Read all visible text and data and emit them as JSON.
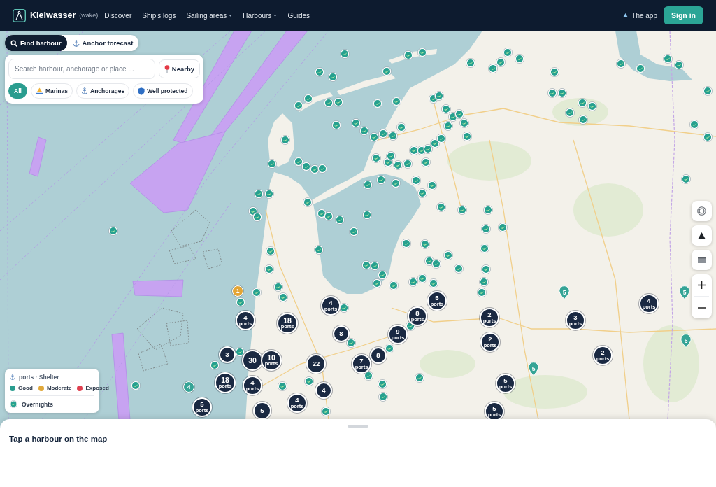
{
  "navbar": {
    "brand": {
      "name": "Kielwasser",
      "subtitle": "(wake)"
    },
    "links": [
      {
        "label": "Discover",
        "dropdown": false
      },
      {
        "label": "Ship’s logs",
        "dropdown": false
      },
      {
        "label": "Sailing areas",
        "dropdown": true
      },
      {
        "label": "Harbours",
        "dropdown": true
      },
      {
        "label": "Guides",
        "dropdown": false
      }
    ],
    "app_link": "The app",
    "sign_in": "Sign in"
  },
  "search_panel": {
    "tabs": [
      {
        "kind": "search",
        "label": "Find harbour",
        "selected": true
      },
      {
        "kind": "anchor",
        "label": "Anchor forecast",
        "selected": false
      }
    ],
    "search": {
      "placeholder": "Search harbour, anchorage or place ..."
    },
    "nearby": "Nearby",
    "filters": [
      {
        "kind": "all",
        "label": "All",
        "selected": true
      },
      {
        "kind": "marina",
        "label": "Marinas",
        "selected": false
      },
      {
        "kind": "anchorage",
        "label": "Anchorages",
        "selected": false
      },
      {
        "kind": "shelter",
        "label": "Well protected",
        "selected": false
      }
    ]
  },
  "map": {
    "badges": [
      {
        "kind": "round",
        "count": "1",
        "color": "#e3a535"
      },
      {
        "kind": "drop",
        "count": "5",
        "color": "#35a496"
      },
      {
        "kind": "drop",
        "count": "5",
        "color": "#35a496"
      },
      {
        "kind": "drop",
        "count": "5",
        "color": "#35a496"
      },
      {
        "kind": "drop",
        "count": "5",
        "color": "#35a496"
      },
      {
        "kind": "round",
        "count": "4",
        "color": "#35a496"
      }
    ],
    "clusters": [
      {
        "count": "4",
        "unit": "ports"
      },
      {
        "count": "5",
        "unit": "ports"
      },
      {
        "count": "4",
        "unit": "ports"
      },
      {
        "count": "4",
        "unit": "ports"
      },
      {
        "count": "18",
        "unit": "ports"
      },
      {
        "count": "8",
        "unit": "ports"
      },
      {
        "count": "2",
        "unit": "ports"
      },
      {
        "count": "3",
        "unit": "ports"
      },
      {
        "count": "8"
      },
      {
        "count": "9",
        "unit": "ports"
      },
      {
        "count": "2",
        "unit": "ports"
      },
      {
        "count": "3"
      },
      {
        "count": "30"
      },
      {
        "count": "10",
        "unit": "ports"
      },
      {
        "count": "22"
      },
      {
        "count": "7",
        "unit": "ports"
      },
      {
        "count": "8"
      },
      {
        "count": "2",
        "unit": "ports"
      },
      {
        "count": "18",
        "unit": "ports"
      },
      {
        "count": "4",
        "unit": "ports"
      },
      {
        "count": "4"
      },
      {
        "count": "5",
        "unit": "ports"
      },
      {
        "count": "5",
        "unit": "ports"
      },
      {
        "count": "5"
      },
      {
        "count": "4",
        "unit": "ports"
      },
      {
        "count": "5",
        "unit": "ports"
      }
    ]
  },
  "map_controls": [
    {
      "kind": "locate"
    },
    {
      "kind": "terrain"
    },
    {
      "kind": "layers"
    },
    {
      "kind": "zoom_in"
    },
    {
      "kind": "zoom_out"
    }
  ],
  "legend": {
    "title": "ports · Shelter",
    "items": [
      {
        "label": "Good",
        "color": "#2a9d8f"
      },
      {
        "label": "Moderate",
        "color": "#e0a83a"
      },
      {
        "label": "Exposed",
        "color": "#e0404f"
      }
    ],
    "overnights": "Overnights"
  },
  "sheet": {
    "prompt": "Tap a harbour on the map"
  }
}
